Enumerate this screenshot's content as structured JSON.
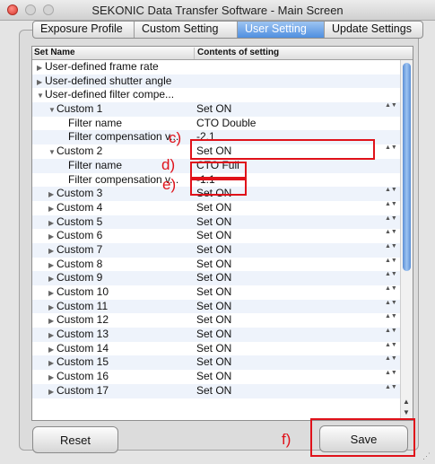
{
  "window": {
    "title": "SEKONIC Data Transfer Software - Main Screen"
  },
  "tabs": [
    {
      "label": "Exposure Profile"
    },
    {
      "label": "Custom Setting"
    },
    {
      "label": "User Setting",
      "active": true
    },
    {
      "label": "Update Settings"
    }
  ],
  "table": {
    "col1": "Set Name",
    "col2": "Contents of setting",
    "rows": [
      {
        "name": "User-defined frame rate",
        "value": ""
      },
      {
        "name": "User-defined shutter angle",
        "value": ""
      },
      {
        "name": "User-defined filter compe...",
        "value": ""
      },
      {
        "name": "Custom 1",
        "value": "Set ON"
      },
      {
        "name": "Filter name",
        "value": "CTO Double"
      },
      {
        "name": "Filter compensation v...",
        "value": "-2.1"
      },
      {
        "name": "Custom 2",
        "value": "Set ON"
      },
      {
        "name": "Filter name",
        "value": "CTO Full"
      },
      {
        "name": "Filter compensation v...",
        "value": "-1.1"
      },
      {
        "name": "Custom 3",
        "value": "Set ON"
      },
      {
        "name": "Custom 4",
        "value": "Set ON"
      },
      {
        "name": "Custom 5",
        "value": "Set ON"
      },
      {
        "name": "Custom 6",
        "value": "Set ON"
      },
      {
        "name": "Custom 7",
        "value": "Set ON"
      },
      {
        "name": "Custom 8",
        "value": "Set ON"
      },
      {
        "name": "Custom 9",
        "value": "Set ON"
      },
      {
        "name": "Custom 10",
        "value": "Set ON"
      },
      {
        "name": "Custom 11",
        "value": "Set ON"
      },
      {
        "name": "Custom 12",
        "value": "Set ON"
      },
      {
        "name": "Custom 13",
        "value": "Set ON"
      },
      {
        "name": "Custom 14",
        "value": "Set ON"
      },
      {
        "name": "Custom 15",
        "value": "Set ON"
      },
      {
        "name": "Custom 16",
        "value": "Set ON"
      },
      {
        "name": "Custom 17",
        "value": "Set ON"
      }
    ]
  },
  "annotations": {
    "c": "c)",
    "d": "d)",
    "e": "e)",
    "f": "f)"
  },
  "buttons": {
    "reset": "Reset",
    "save": "Save"
  },
  "icons": {
    "expanded": "▼",
    "collapsed": "▶",
    "stepper": "▲▼"
  },
  "colors": {
    "annotation": "#e0121a",
    "tab_active": "#4f8fe0",
    "close": "#d8372c"
  }
}
